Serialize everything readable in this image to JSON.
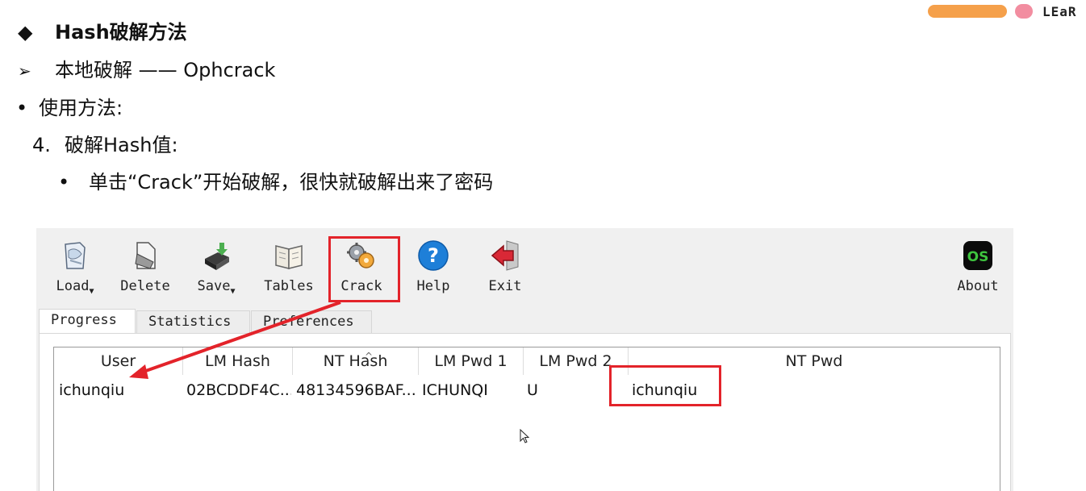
{
  "slide": {
    "heading_bullet": "◆",
    "heading": "Hash破解方法",
    "sub_bullet": "➢",
    "subheading": "本地破解 —— Ophcrack",
    "usage_bullet": "•",
    "usage": "使用方法:",
    "step_num": "4.",
    "step": "破解Hash值:",
    "detail_bullet": "•",
    "detail": "单击“Crack”开始破解，很快就破解出来了密码"
  },
  "logo": {
    "text": "LEaR",
    "colors": {
      "pill": "#f5a04a",
      "dot": "#f28da0"
    }
  },
  "toolbar": {
    "load": "Load",
    "delete": "Delete",
    "save": "Save",
    "tables": "Tables",
    "crack": "Crack",
    "help": "Help",
    "exit": "Exit",
    "about": "About",
    "about_icon_text": "OS"
  },
  "tabs": [
    "Progress",
    "Statistics",
    "Preferences"
  ],
  "table": {
    "columns": [
      "User",
      "LM Hash",
      "NT Hash",
      "LM Pwd 1",
      "LM Pwd 2",
      "NT Pwd"
    ],
    "rows": [
      [
        "ichunqiu",
        "02BCDDF4C...",
        "48134596BAF...",
        "ICHUNQI",
        "U",
        "ichunqiu"
      ]
    ]
  },
  "colors": {
    "highlight": "#e3232a",
    "help_blue": "#1e7fd8",
    "exit_red": "#d92836",
    "about_green": "#3ec43e"
  }
}
